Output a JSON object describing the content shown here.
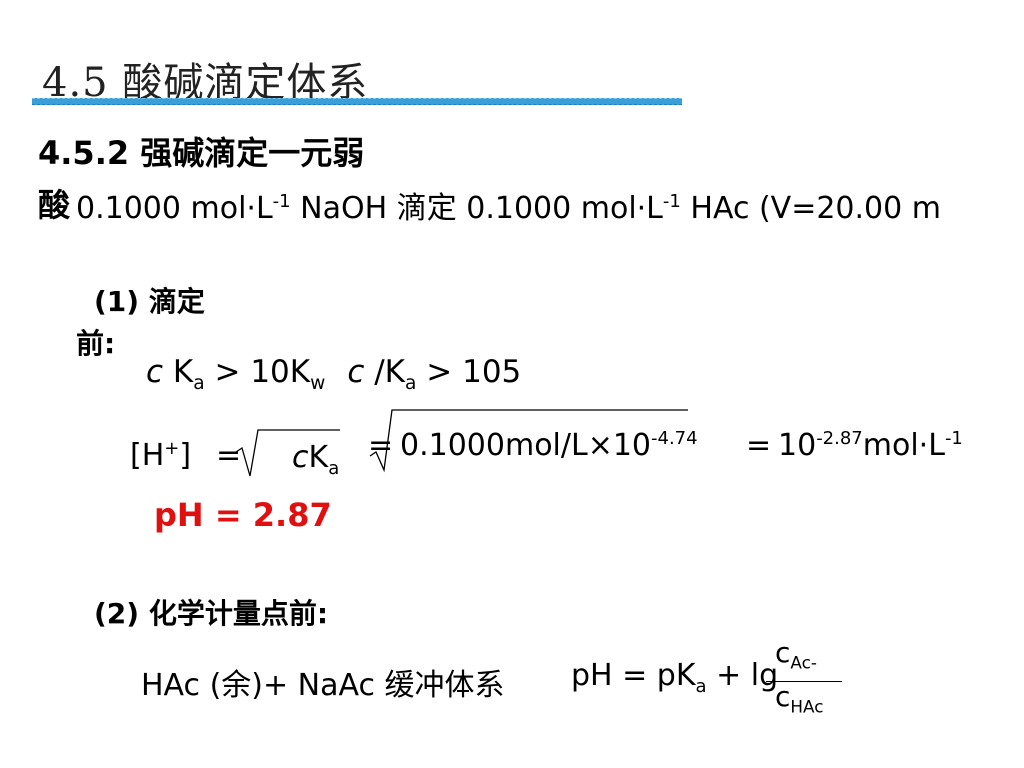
{
  "slide": {
    "title": "4.5 酸碱滴定体系",
    "section_heading": "4.5.2 强碱滴定一元弱",
    "section_heading_tail": "酸",
    "conditions": {
      "part1": "0.1000 mol·L",
      "exp1": "-1",
      "part2": " NaOH 滴定 0.1000  mol·L",
      "exp2": "-1",
      "part3": " HAc   (V=20.00 m"
    },
    "step1": {
      "heading_line1": "(1) 滴定",
      "heading_line2": "前:",
      "criteria": {
        "c1": "c",
        "k1": " K",
        "sub_a1": "a",
        "rel1": " > 10K",
        "sub_w": "w",
        "c2": "c",
        "k2": " /K",
        "sub_a2": "a",
        "rel2": " > 105"
      },
      "h_plus": {
        "label": "[H",
        "sup_plus": "+",
        "label_close": "]",
        "eq1": "=",
        "root_c": "c",
        "root_k": "K",
        "root_sub_a": "a",
        "eq2": "=",
        "value_text": "0.1000mol/L×10",
        "value_exp": "-4.74",
        "eq3": "=",
        "result_base": "10",
        "result_exp": "-2.87",
        "result_unit": "mol·L",
        "result_unit_exp": "-1"
      },
      "ph_result": "pH = 2.87"
    },
    "step2": {
      "heading": "(2) 化学计量点前:",
      "buffer_label": "HAc (余)+ NaAc 缓冲体系",
      "ph_formula": {
        "lhs": "pH = pK",
        "sub_a": "a",
        "plus_lg": " + lg",
        "numerator_c": "c",
        "numerator_sub": "Ac-",
        "denominator_c": "c",
        "denominator_sub": "HAc"
      }
    }
  },
  "colors": {
    "title_rule": "#3a9fd8",
    "ph_result": "#e01010"
  }
}
